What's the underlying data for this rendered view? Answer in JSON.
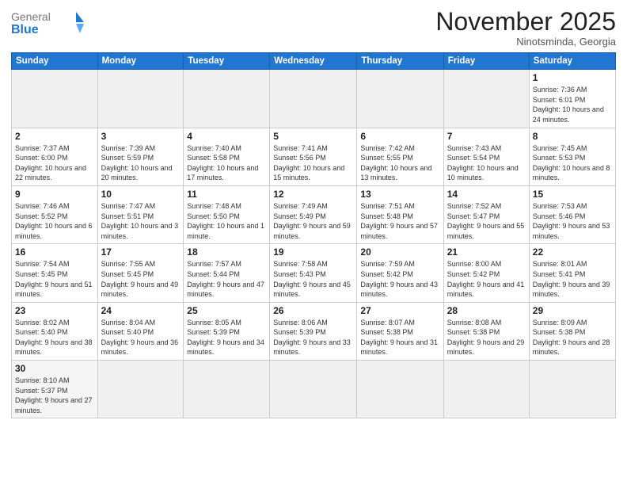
{
  "logo": {
    "general": "General",
    "blue": "Blue"
  },
  "header": {
    "month": "November 2025",
    "location": "Ninotsminda, Georgia"
  },
  "weekdays": [
    "Sunday",
    "Monday",
    "Tuesday",
    "Wednesday",
    "Thursday",
    "Friday",
    "Saturday"
  ],
  "weeks": [
    [
      {
        "day": "",
        "info": ""
      },
      {
        "day": "",
        "info": ""
      },
      {
        "day": "",
        "info": ""
      },
      {
        "day": "",
        "info": ""
      },
      {
        "day": "",
        "info": ""
      },
      {
        "day": "",
        "info": ""
      },
      {
        "day": "1",
        "info": "Sunrise: 7:36 AM\nSunset: 6:01 PM\nDaylight: 10 hours\nand 24 minutes."
      }
    ],
    [
      {
        "day": "2",
        "info": "Sunrise: 7:37 AM\nSunset: 6:00 PM\nDaylight: 10 hours\nand 22 minutes."
      },
      {
        "day": "3",
        "info": "Sunrise: 7:39 AM\nSunset: 5:59 PM\nDaylight: 10 hours\nand 20 minutes."
      },
      {
        "day": "4",
        "info": "Sunrise: 7:40 AM\nSunset: 5:58 PM\nDaylight: 10 hours\nand 17 minutes."
      },
      {
        "day": "5",
        "info": "Sunrise: 7:41 AM\nSunset: 5:56 PM\nDaylight: 10 hours\nand 15 minutes."
      },
      {
        "day": "6",
        "info": "Sunrise: 7:42 AM\nSunset: 5:55 PM\nDaylight: 10 hours\nand 13 minutes."
      },
      {
        "day": "7",
        "info": "Sunrise: 7:43 AM\nSunset: 5:54 PM\nDaylight: 10 hours\nand 10 minutes."
      },
      {
        "day": "8",
        "info": "Sunrise: 7:45 AM\nSunset: 5:53 PM\nDaylight: 10 hours\nand 8 minutes."
      }
    ],
    [
      {
        "day": "9",
        "info": "Sunrise: 7:46 AM\nSunset: 5:52 PM\nDaylight: 10 hours\nand 6 minutes."
      },
      {
        "day": "10",
        "info": "Sunrise: 7:47 AM\nSunset: 5:51 PM\nDaylight: 10 hours\nand 3 minutes."
      },
      {
        "day": "11",
        "info": "Sunrise: 7:48 AM\nSunset: 5:50 PM\nDaylight: 10 hours\nand 1 minute."
      },
      {
        "day": "12",
        "info": "Sunrise: 7:49 AM\nSunset: 5:49 PM\nDaylight: 9 hours\nand 59 minutes."
      },
      {
        "day": "13",
        "info": "Sunrise: 7:51 AM\nSunset: 5:48 PM\nDaylight: 9 hours\nand 57 minutes."
      },
      {
        "day": "14",
        "info": "Sunrise: 7:52 AM\nSunset: 5:47 PM\nDaylight: 9 hours\nand 55 minutes."
      },
      {
        "day": "15",
        "info": "Sunrise: 7:53 AM\nSunset: 5:46 PM\nDaylight: 9 hours\nand 53 minutes."
      }
    ],
    [
      {
        "day": "16",
        "info": "Sunrise: 7:54 AM\nSunset: 5:45 PM\nDaylight: 9 hours\nand 51 minutes."
      },
      {
        "day": "17",
        "info": "Sunrise: 7:55 AM\nSunset: 5:45 PM\nDaylight: 9 hours\nand 49 minutes."
      },
      {
        "day": "18",
        "info": "Sunrise: 7:57 AM\nSunset: 5:44 PM\nDaylight: 9 hours\nand 47 minutes."
      },
      {
        "day": "19",
        "info": "Sunrise: 7:58 AM\nSunset: 5:43 PM\nDaylight: 9 hours\nand 45 minutes."
      },
      {
        "day": "20",
        "info": "Sunrise: 7:59 AM\nSunset: 5:42 PM\nDaylight: 9 hours\nand 43 minutes."
      },
      {
        "day": "21",
        "info": "Sunrise: 8:00 AM\nSunset: 5:42 PM\nDaylight: 9 hours\nand 41 minutes."
      },
      {
        "day": "22",
        "info": "Sunrise: 8:01 AM\nSunset: 5:41 PM\nDaylight: 9 hours\nand 39 minutes."
      }
    ],
    [
      {
        "day": "23",
        "info": "Sunrise: 8:02 AM\nSunset: 5:40 PM\nDaylight: 9 hours\nand 38 minutes."
      },
      {
        "day": "24",
        "info": "Sunrise: 8:04 AM\nSunset: 5:40 PM\nDaylight: 9 hours\nand 36 minutes."
      },
      {
        "day": "25",
        "info": "Sunrise: 8:05 AM\nSunset: 5:39 PM\nDaylight: 9 hours\nand 34 minutes."
      },
      {
        "day": "26",
        "info": "Sunrise: 8:06 AM\nSunset: 5:39 PM\nDaylight: 9 hours\nand 33 minutes."
      },
      {
        "day": "27",
        "info": "Sunrise: 8:07 AM\nSunset: 5:38 PM\nDaylight: 9 hours\nand 31 minutes."
      },
      {
        "day": "28",
        "info": "Sunrise: 8:08 AM\nSunset: 5:38 PM\nDaylight: 9 hours\nand 29 minutes."
      },
      {
        "day": "29",
        "info": "Sunrise: 8:09 AM\nSunset: 5:38 PM\nDaylight: 9 hours\nand 28 minutes."
      }
    ],
    [
      {
        "day": "30",
        "info": "Sunrise: 8:10 AM\nSunset: 5:37 PM\nDaylight: 9 hours\nand 27 minutes."
      },
      {
        "day": "",
        "info": ""
      },
      {
        "day": "",
        "info": ""
      },
      {
        "day": "",
        "info": ""
      },
      {
        "day": "",
        "info": ""
      },
      {
        "day": "",
        "info": ""
      },
      {
        "day": "",
        "info": ""
      }
    ]
  ]
}
